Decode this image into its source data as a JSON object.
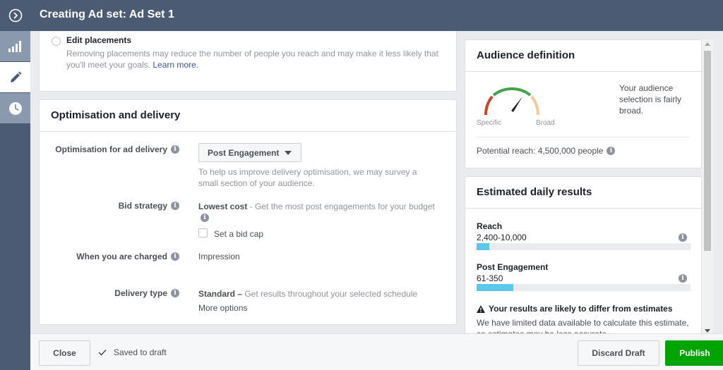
{
  "window": {
    "title": "Creating Ad set: Ad Set 1"
  },
  "placements": {
    "option_label": "Edit placements",
    "description": "Removing placements may reduce the number of people you reach and may make it less likely that you'll meet your goals.",
    "link": "Learn more."
  },
  "optimisation": {
    "title": "Optimisation and delivery",
    "opt_label": "Optimisation for ad delivery",
    "opt_value": "Post Engagement",
    "opt_hint": "To help us improve delivery optimisation, we may survey a small section of your audience.",
    "bid_label": "Bid strategy",
    "bid_value": "Lowest cost",
    "bid_desc": " - Get the most post engagements for your budget",
    "bid_cap": "Set a bid cap",
    "charged_label": "When you are charged",
    "charged_value": "Impression",
    "delivery_label": "Delivery type",
    "delivery_value": "Standard –",
    "delivery_desc": " Get results throughout your selected schedule",
    "more_options": "More options"
  },
  "audience": {
    "title": "Audience definition",
    "gauge_left": "Specific",
    "gauge_right": "Broad",
    "description": "Your audience selection is fairly broad.",
    "potential_reach": "Potential reach: 4,500,000 people"
  },
  "estimates": {
    "title": "Estimated daily results",
    "reach_label": "Reach",
    "reach_value": "2,400-10,000",
    "reach_fill": 0.06,
    "engagement_label": "Post Engagement",
    "engagement_value": "61-350",
    "engagement_fill": 0.17,
    "warning": "Your results are likely to differ from estimates",
    "warning_desc": "We have limited data available to calculate this estimate, so estimates may be less accurate."
  },
  "footer": {
    "close": "Close",
    "saved": "Saved to draft",
    "discard": "Discard Draft",
    "publish": "Publish"
  },
  "icons": {
    "info": "i"
  },
  "colors": {
    "publish": "#00a400",
    "bar_fill": "#5bc7ea",
    "header": "#4b5b73"
  }
}
